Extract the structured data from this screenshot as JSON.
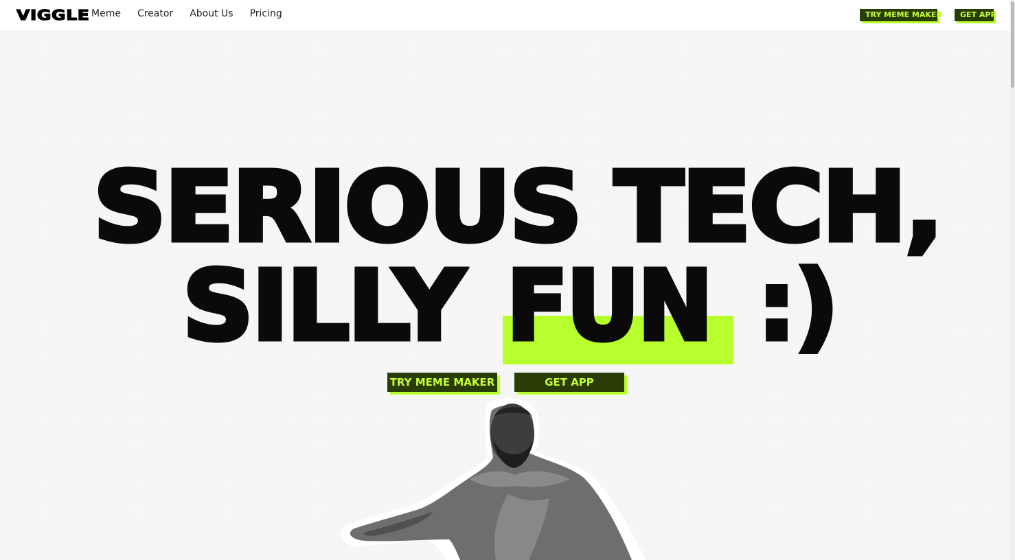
{
  "header": {
    "logo": "VIGGLE",
    "nav": [
      "Meme",
      "Creator",
      "About Us",
      "Pricing"
    ],
    "try_meme_maker": "TRY MEME MAKER",
    "get_app": "GET APP"
  },
  "hero": {
    "line1": "SERIOUS TECH,",
    "line2_part1": "SILLY",
    "line2_highlight": "FUN",
    "line2_part2": ":)"
  },
  "cta": {
    "try_meme_maker": "TRY MEME MAKER",
    "get_app": "GET APP"
  },
  "colors": {
    "accent": "#b8ff2e",
    "button_bg": "#2b3d06",
    "button_text": "#c6ff33"
  },
  "icons": {
    "hero_figure": "grayscale-man-dancing-image"
  }
}
